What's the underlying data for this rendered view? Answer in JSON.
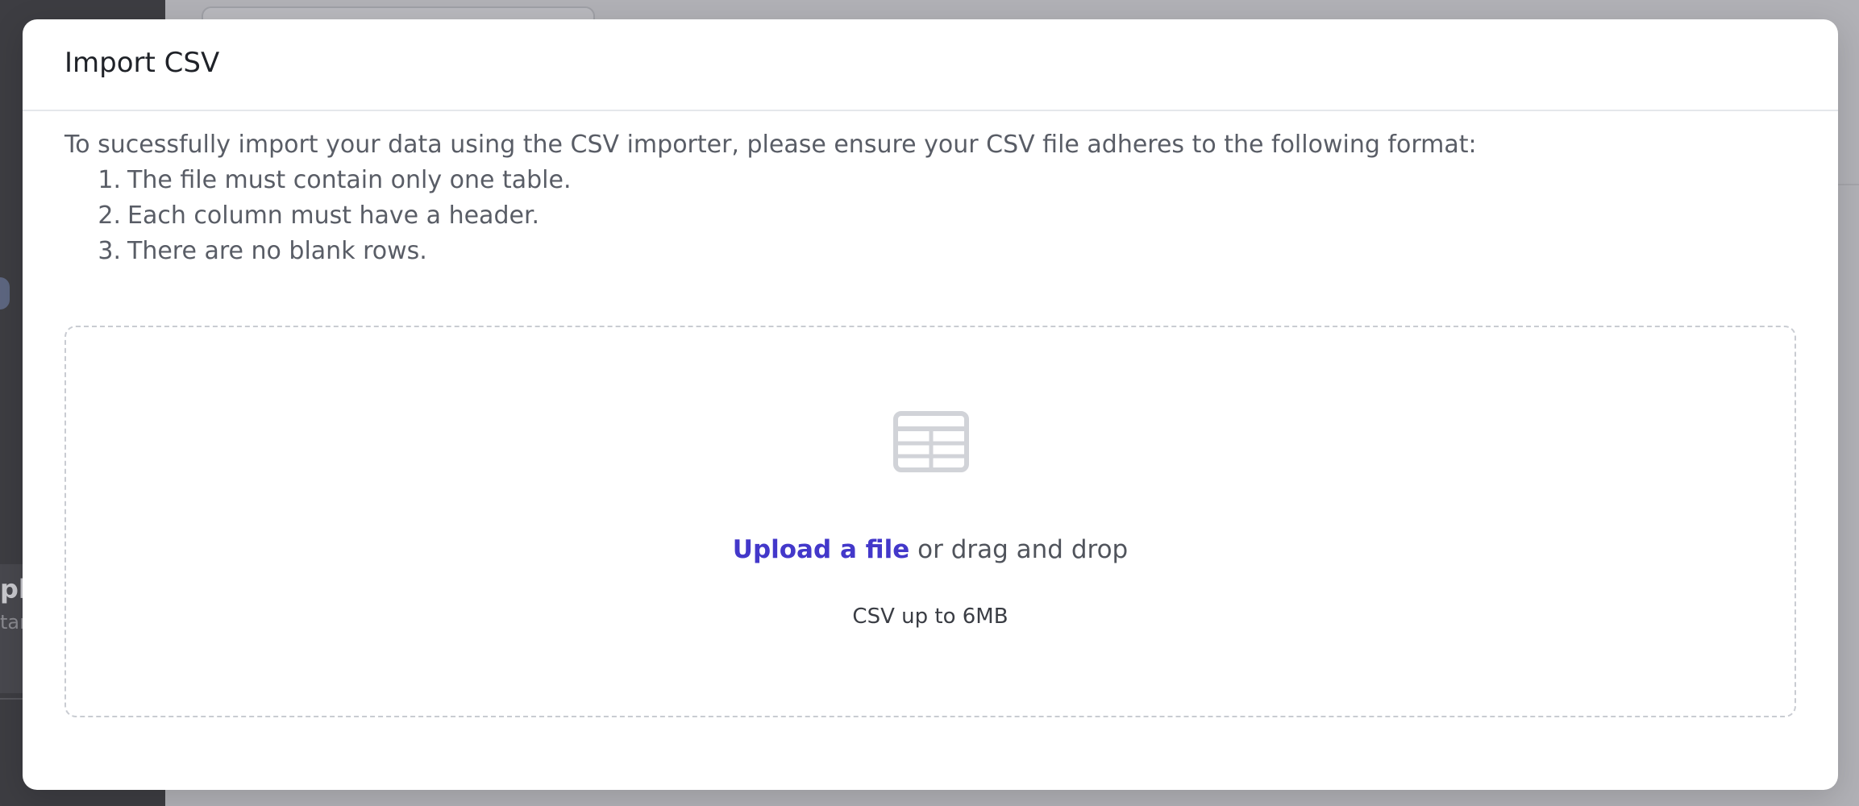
{
  "background": {
    "sidebar_partial_title": "pl",
    "sidebar_partial_sub": "tar"
  },
  "modal": {
    "title": "Import CSV",
    "intro": "To sucessfully import your data using the CSV importer, please ensure your CSV file adheres to the following format:",
    "rules": [
      {
        "num": "1.",
        "text": "The file must contain only one table."
      },
      {
        "num": "2.",
        "text": "Each column must have a header."
      },
      {
        "num": "3.",
        "text": "There are no blank rows."
      }
    ],
    "dropzone": {
      "icon": "table-icon",
      "upload_link": "Upload a file",
      "upload_suffix": " or drag and drop",
      "hint": "CSV up to 6MB"
    }
  },
  "colors": {
    "link": "#4338ca",
    "overlay": "#b3b3b8"
  }
}
